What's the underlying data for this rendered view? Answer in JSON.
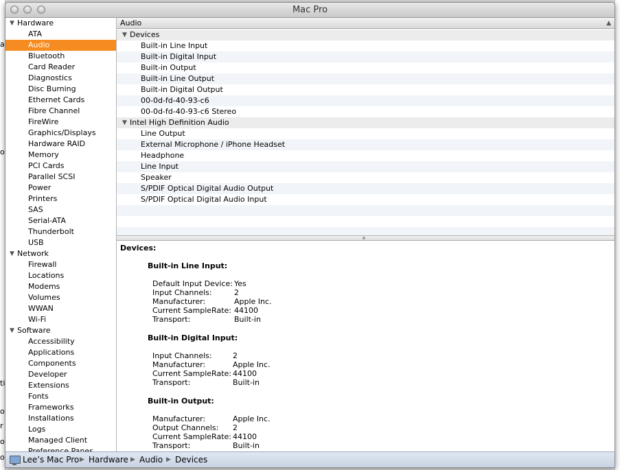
{
  "window": {
    "title": "Mac Pro"
  },
  "sidebar": {
    "categories": [
      {
        "label": "Hardware",
        "items": [
          "ATA",
          "Audio",
          "Bluetooth",
          "Card Reader",
          "Diagnostics",
          "Disc Burning",
          "Ethernet Cards",
          "Fibre Channel",
          "FireWire",
          "Graphics/Displays",
          "Hardware RAID",
          "Memory",
          "PCI Cards",
          "Parallel SCSI",
          "Power",
          "Printers",
          "SAS",
          "Serial-ATA",
          "Thunderbolt",
          "USB"
        ]
      },
      {
        "label": "Network",
        "items": [
          "Firewall",
          "Locations",
          "Modems",
          "Volumes",
          "WWAN",
          "Wi-Fi"
        ]
      },
      {
        "label": "Software",
        "items": [
          "Accessibility",
          "Applications",
          "Components",
          "Developer",
          "Extensions",
          "Fonts",
          "Frameworks",
          "Installations",
          "Logs",
          "Managed Client",
          "Preference Panes"
        ]
      }
    ],
    "selected": "Audio"
  },
  "list": {
    "header": "Audio",
    "groups": [
      {
        "label": "Devices",
        "items": [
          "Built-in Line Input",
          "Built-in Digital Input",
          "Built-in Output",
          "Built-in Line Output",
          "Built-in Digital Output",
          "00-0d-fd-40-93-c6",
          "00-0d-fd-40-93-c6 Stereo"
        ]
      },
      {
        "label": "Intel High Definition Audio",
        "items": [
          "Line Output",
          "External Microphone / iPhone Headset",
          "Headphone",
          "Line Input",
          "Speaker",
          "S/PDIF Optical Digital Audio Output",
          "S/PDIF Optical Digital Audio Input"
        ]
      }
    ]
  },
  "detail": {
    "title": "Devices:",
    "sections": [
      {
        "name": "Built-in Line Input:",
        "rows": [
          [
            "Default Input Device:",
            "Yes"
          ],
          [
            "Input Channels:",
            "2"
          ],
          [
            "Manufacturer:",
            "Apple Inc."
          ],
          [
            "Current SampleRate:",
            "44100"
          ],
          [
            "Transport:",
            "Built-in"
          ]
        ]
      },
      {
        "name": "Built-in Digital Input:",
        "rows": [
          [
            "Input Channels:",
            "2"
          ],
          [
            "Manufacturer:",
            "Apple Inc."
          ],
          [
            "Current SampleRate:",
            "44100"
          ],
          [
            "Transport:",
            "Built-in"
          ]
        ]
      },
      {
        "name": "Built-in Output:",
        "rows": [
          [
            "Manufacturer:",
            "Apple Inc."
          ],
          [
            "Output Channels:",
            "2"
          ],
          [
            "Current SampleRate:",
            "44100"
          ],
          [
            "Transport:",
            "Built-in"
          ]
        ]
      }
    ]
  },
  "breadcrumb": [
    "Lee’s Mac Pro",
    "Hardware",
    "Audio",
    "Devices"
  ],
  "background_window": {
    "edge_text": [
      "a",
      "o",
      "ti",
      "o",
      "r",
      "o",
      "o"
    ]
  },
  "colors": {
    "selection": "#f68c21",
    "row_alt": "#f1f4f8",
    "statusbar": "#c7d2e2"
  },
  "icons": {
    "disclosure": "disclosure-triangle-icon",
    "computer": "computer-icon",
    "sort": "sort-ascending-icon"
  }
}
